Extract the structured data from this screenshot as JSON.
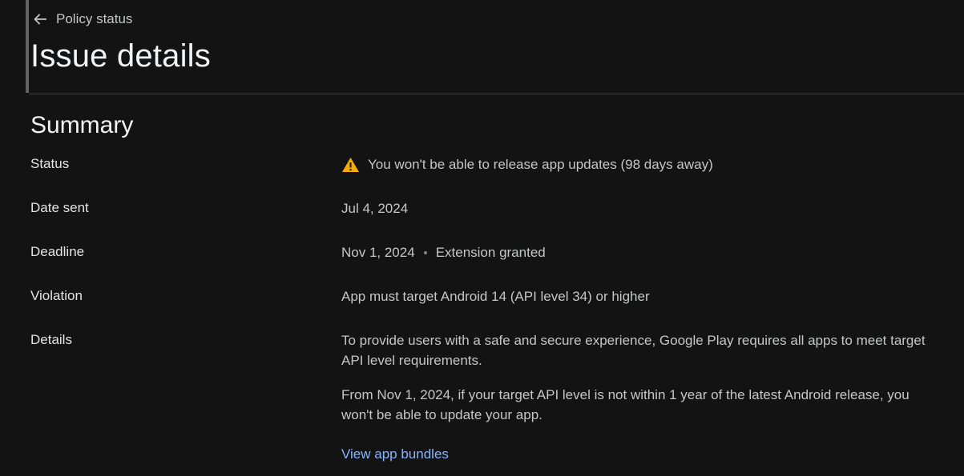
{
  "header": {
    "back_label": "Policy status",
    "title": "Issue details"
  },
  "summary": {
    "title": "Summary",
    "status": {
      "label": "Status",
      "value": "You won't be able to release app updates (98 days away)"
    },
    "date_sent": {
      "label": "Date sent",
      "value": "Jul 4, 2024"
    },
    "deadline": {
      "label": "Deadline",
      "date": "Nov 1, 2024",
      "note": "Extension granted"
    },
    "violation": {
      "label": "Violation",
      "value": "App must target Android 14 (API level 34) or higher"
    },
    "details": {
      "label": "Details",
      "paragraph_1": "To provide users with a safe and secure experience, Google Play requires all apps to meet target API level requirements.",
      "paragraph_2": "From Nov 1, 2024, if your target API level is not within 1 year of the latest Android release, you won't be able to update your app.",
      "link": "View app bundles"
    }
  },
  "colors": {
    "background": "#131314",
    "warning": "#f9ab00",
    "link": "#8ab4f8"
  }
}
